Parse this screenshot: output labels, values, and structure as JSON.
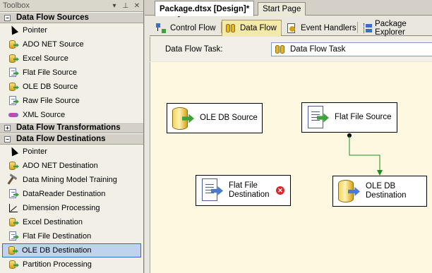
{
  "toolbox": {
    "title": "Toolbox",
    "pin_label": "ᵖ",
    "close_label": "✕",
    "categories": [
      {
        "name": "Data Flow Sources",
        "expander": "−",
        "items": [
          {
            "label": "Pointer",
            "icon": "pointer-icon"
          },
          {
            "label": "ADO NET Source",
            "icon": "ado-net-source-icon"
          },
          {
            "label": "Excel Source",
            "icon": "excel-source-icon"
          },
          {
            "label": "Flat File Source",
            "icon": "flat-file-source-icon"
          },
          {
            "label": "OLE DB Source",
            "icon": "ole-db-source-icon"
          },
          {
            "label": "Raw File Source",
            "icon": "raw-file-source-icon"
          },
          {
            "label": "XML Source",
            "icon": "xml-source-icon"
          }
        ]
      },
      {
        "name": "Data Flow Transformations",
        "expander": "+",
        "items": []
      },
      {
        "name": "Data Flow Destinations",
        "expander": "−",
        "items": [
          {
            "label": "Pointer",
            "icon": "pointer-icon"
          },
          {
            "label": "ADO NET Destination",
            "icon": "ado-net-destination-icon"
          },
          {
            "label": "Data Mining Model Training",
            "icon": "data-mining-icon"
          },
          {
            "label": "DataReader Destination",
            "icon": "datareader-destination-icon"
          },
          {
            "label": "Dimension Processing",
            "icon": "dimension-processing-icon"
          },
          {
            "label": "Excel Destination",
            "icon": "excel-destination-icon"
          },
          {
            "label": "Flat File Destination",
            "icon": "flat-file-destination-icon"
          },
          {
            "label": "OLE DB Destination",
            "icon": "ole-db-destination-icon",
            "selected": true
          },
          {
            "label": "Partition Processing",
            "icon": "partition-processing-icon"
          }
        ]
      }
    ]
  },
  "document_tabs": {
    "active": "Package.dtsx [Design]*",
    "inactive": "Start Page"
  },
  "designer_tabs": [
    {
      "label": "Control Flow",
      "icon": "control-flow-icon"
    },
    {
      "label": "Data Flow",
      "icon": "data-flow-icon",
      "active": true
    },
    {
      "label": "Event Handlers",
      "icon": "event-handlers-icon"
    },
    {
      "label": "Package Explorer",
      "icon": "package-explorer-icon"
    }
  ],
  "task_bar": {
    "label": "Data Flow Task:",
    "selected_task": "Data Flow Task"
  },
  "canvas": {
    "components": [
      {
        "id": "ole-db-source",
        "label": "OLE DB Source",
        "icon": "ole-db-source-icon",
        "error": false
      },
      {
        "id": "flat-file-source",
        "label": "Flat File Source",
        "icon": "flat-file-source-icon",
        "error": false
      },
      {
        "id": "flat-file-destination",
        "label": "Flat File\nDestination",
        "icon": "flat-file-destination-icon",
        "error": true,
        "error_glyph": "✕"
      },
      {
        "id": "ole-db-destination",
        "label": "OLE DB\nDestination",
        "icon": "ole-db-destination-icon",
        "error": false
      }
    ],
    "colors": {
      "canvas_bg": "#fdf8e0",
      "path_color": "#1e8c1e",
      "error_color": "#d8262c",
      "selection_bg": "#c1d2ee"
    }
  }
}
